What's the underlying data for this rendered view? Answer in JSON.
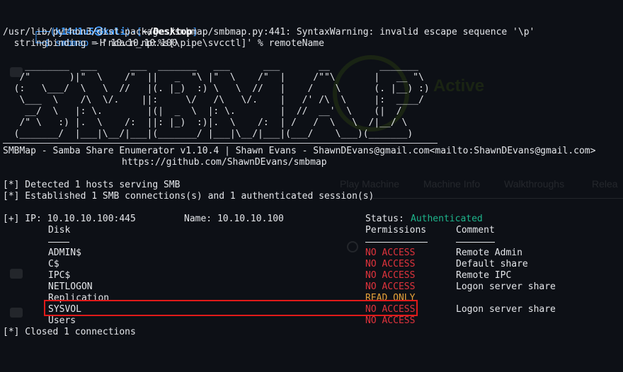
{
  "prompt": {
    "user": "k14d1u5",
    "skull": "㉿",
    "host": "kali",
    "dir": "~/Desktop",
    "cmd_name": "smbmap",
    "cmd_args": " -H 10.10.10.100",
    "top_prefix": "┌──(",
    "bottom_prefix": "└─$ "
  },
  "warning_lines": [
    "/usr/lib/python3/dist-packages/smbmap/smbmap.py:441: SyntaxWarning: invalid escape sequence '\\p'",
    "  stringbinding = 'ncacn_np:%s[\\pipe\\svcctl]' % remoteName"
  ],
  "banner": "    ________  ___      ___  _______   ___      ___       __         _______\n   /\"       )|\"  \\    /\"  ||   _  \"\\ |\"  \\    /\"  |     /\"\"\\       |   __ \"\\\n  (:   \\___/  \\   \\  //   |(. |_)  :) \\   \\  //   |    /    \\      (. |__) :)\n   \\___  \\    /\\  \\/.    ||:     \\/   /\\   \\/.    |   /' /\\  \\     |:  ____/\n    __/  \\   |: \\.        |(|  _  \\  |: \\.        |  //  __'  \\    (|  /\n   /\" \\   :) |.  \\    /:  ||: |_)  :)|.  \\    /:  | /   /  \\   \\  /|__/ \\\n  (_______/  |___|\\__/|___|(_______/ |___|\\__/|___|(___/    \\___)(_______)",
  "version_line": "SMBMap - Samba Share Enumerator v1.10.4 | Shawn Evans - ShawnDEvans@gmail.com<mailto:ShawnDEvans@gmail.com>",
  "url_line": "https://github.com/ShawnDEvans/smbmap",
  "status_lines": [
    "[*] Detected 1 hosts serving SMB",
    "[*] Established 1 SMB connections(s) and 1 authenticated session(s)"
  ],
  "ip_row": {
    "prefix": "[+] IP: 10.10.10.100:445",
    "name": "Name: 10.10.10.100",
    "status_label": "Status: ",
    "status_value": "Authenticated"
  },
  "table_headers": {
    "disk": "Disk",
    "permissions": "Permissions",
    "comment": "Comment"
  },
  "shares": [
    {
      "disk": "ADMIN$",
      "perm": "NO ACCESS",
      "comment": "Remote Admin"
    },
    {
      "disk": "C$",
      "perm": "NO ACCESS",
      "comment": "Default share"
    },
    {
      "disk": "IPC$",
      "perm": "NO ACCESS",
      "comment": "Remote IPC"
    },
    {
      "disk": "NETLOGON",
      "perm": "NO ACCESS",
      "comment": "Logon server share"
    },
    {
      "disk": "Replication",
      "perm": "READ ONLY",
      "comment": ""
    },
    {
      "disk": "SYSVOL",
      "perm": "NO ACCESS",
      "comment": "Logon server share"
    },
    {
      "disk": "Users",
      "perm": "NO ACCESS",
      "comment": ""
    }
  ],
  "closing_line": "[*] Closed 1 connections",
  "background": {
    "active": "Active",
    "nav": [
      "Play Machine",
      "Machine Info",
      "Walkthroughs",
      "Relea"
    ]
  },
  "colors": {
    "background": "#0d1016",
    "prompt_blue": "#3f9bff",
    "authenticated": "#1db58c",
    "no_access": "#e0333c",
    "read_only": "#e6a23a",
    "highlight_box": "#e01a1a"
  }
}
